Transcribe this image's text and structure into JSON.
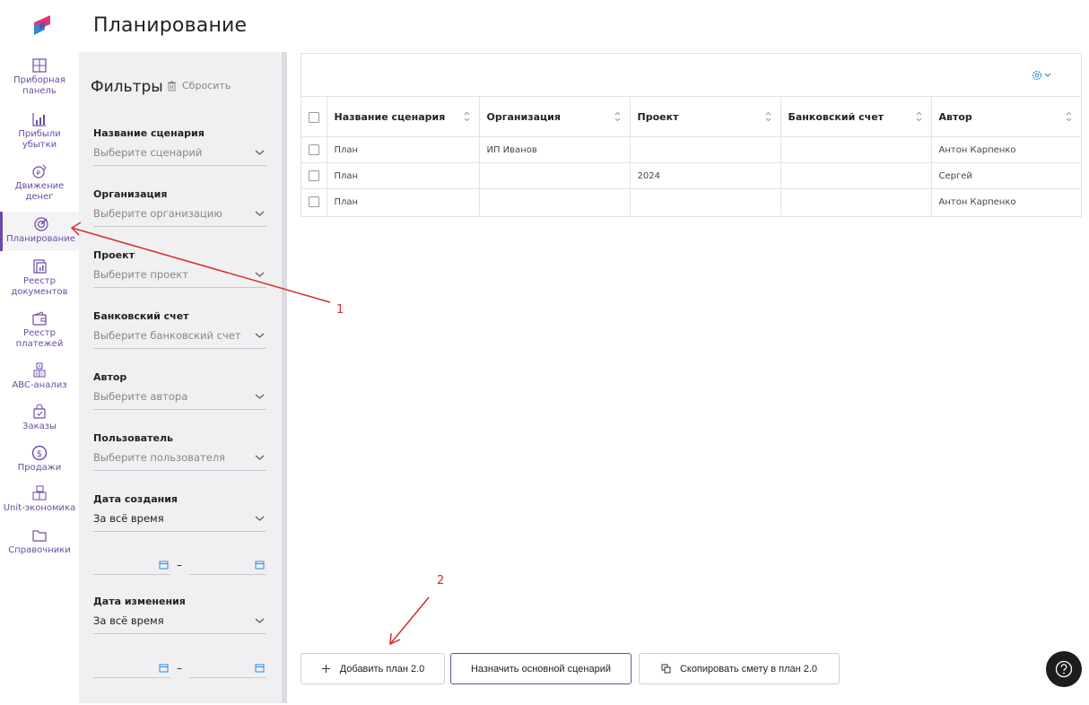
{
  "page": {
    "title": "Планирование"
  },
  "nav": {
    "items": [
      {
        "label": "Приборная панель",
        "icon": "dashboard-icon"
      },
      {
        "label": "Прибыли убытки",
        "icon": "chart-icon"
      },
      {
        "label": "Движение денег",
        "icon": "cashflow-icon"
      },
      {
        "label": "Планирование",
        "icon": "target-icon",
        "active": true
      },
      {
        "label": "Реестр документов",
        "icon": "documents-icon"
      },
      {
        "label": "Реестр платежей",
        "icon": "wallet-icon"
      },
      {
        "label": "ABC-анализ",
        "icon": "abc-icon"
      },
      {
        "label": "Заказы",
        "icon": "bag-icon"
      },
      {
        "label": "Продажи",
        "icon": "dollar-icon"
      },
      {
        "label": "Unit-экономика",
        "icon": "boxes-icon"
      },
      {
        "label": "Справочники",
        "icon": "folder-icon"
      }
    ]
  },
  "filters": {
    "title": "Фильтры",
    "reset_label": "Сбросить",
    "fields": [
      {
        "label": "Название сценария",
        "placeholder": "Выберите сценарий"
      },
      {
        "label": "Организация",
        "placeholder": "Выберите организацию"
      },
      {
        "label": "Проект",
        "placeholder": "Выберите проект"
      },
      {
        "label": "Банковский счет",
        "placeholder": "Выберите банковский счет"
      },
      {
        "label": "Автор",
        "placeholder": "Выберите автора"
      },
      {
        "label": "Пользователь",
        "placeholder": "Выберите пользователя"
      },
      {
        "label": "Дата создания",
        "value": "За всё время"
      },
      {
        "label": "Дата изменения",
        "value": "За всё время"
      }
    ],
    "date_separator": "–"
  },
  "table": {
    "columns": [
      "Название сценария",
      "Организация",
      "Проект",
      "Банковский счет",
      "Автор"
    ],
    "rows": [
      [
        "План",
        "ИП Иванов",
        "",
        "",
        "Антон Карпенко"
      ],
      [
        "План",
        "",
        "2024",
        "",
        "Сергей"
      ],
      [
        "План",
        "",
        "",
        "",
        "Антон Карпенко"
      ]
    ]
  },
  "actions": {
    "add_plan": "Добавить план 2.0",
    "set_main": "Назначить основной сценарий",
    "copy_estimate": "Скопировать смету в план 2.0"
  },
  "annotations": {
    "marker_1": "1",
    "marker_2": "2"
  },
  "colors": {
    "accent": "#6b4aa3",
    "annotation": "#d32f2f",
    "panel": "#f0f0f2"
  }
}
